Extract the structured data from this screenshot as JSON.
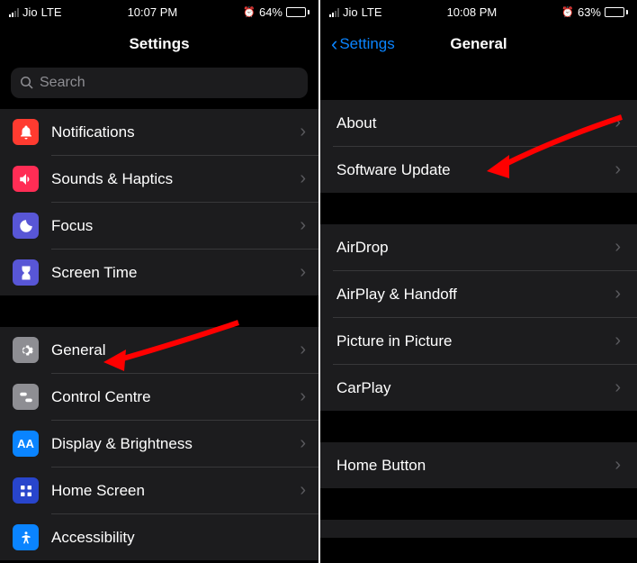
{
  "left": {
    "status": {
      "carrier": "Jio",
      "network": "LTE",
      "time": "10:07 PM",
      "battery_pct": "64%"
    },
    "nav": {
      "title": "Settings"
    },
    "search": {
      "placeholder": "Search"
    },
    "section1": [
      {
        "label": "Notifications",
        "icon": "notifications"
      },
      {
        "label": "Sounds & Haptics",
        "icon": "sounds"
      },
      {
        "label": "Focus",
        "icon": "focus"
      },
      {
        "label": "Screen Time",
        "icon": "screentime"
      }
    ],
    "section2": [
      {
        "label": "General",
        "icon": "general"
      },
      {
        "label": "Control Centre",
        "icon": "control"
      },
      {
        "label": "Display & Brightness",
        "icon": "display"
      },
      {
        "label": "Home Screen",
        "icon": "homescreen"
      },
      {
        "label": "Accessibility",
        "icon": "accessibility"
      }
    ]
  },
  "right": {
    "status": {
      "carrier": "Jio",
      "network": "LTE",
      "time": "10:08 PM",
      "battery_pct": "63%"
    },
    "nav": {
      "back": "Settings",
      "title": "General"
    },
    "section1": [
      {
        "label": "About"
      },
      {
        "label": "Software Update"
      }
    ],
    "section2": [
      {
        "label": "AirDrop"
      },
      {
        "label": "AirPlay & Handoff"
      },
      {
        "label": "Picture in Picture"
      },
      {
        "label": "CarPlay"
      }
    ],
    "section3": [
      {
        "label": "Home Button"
      }
    ]
  }
}
